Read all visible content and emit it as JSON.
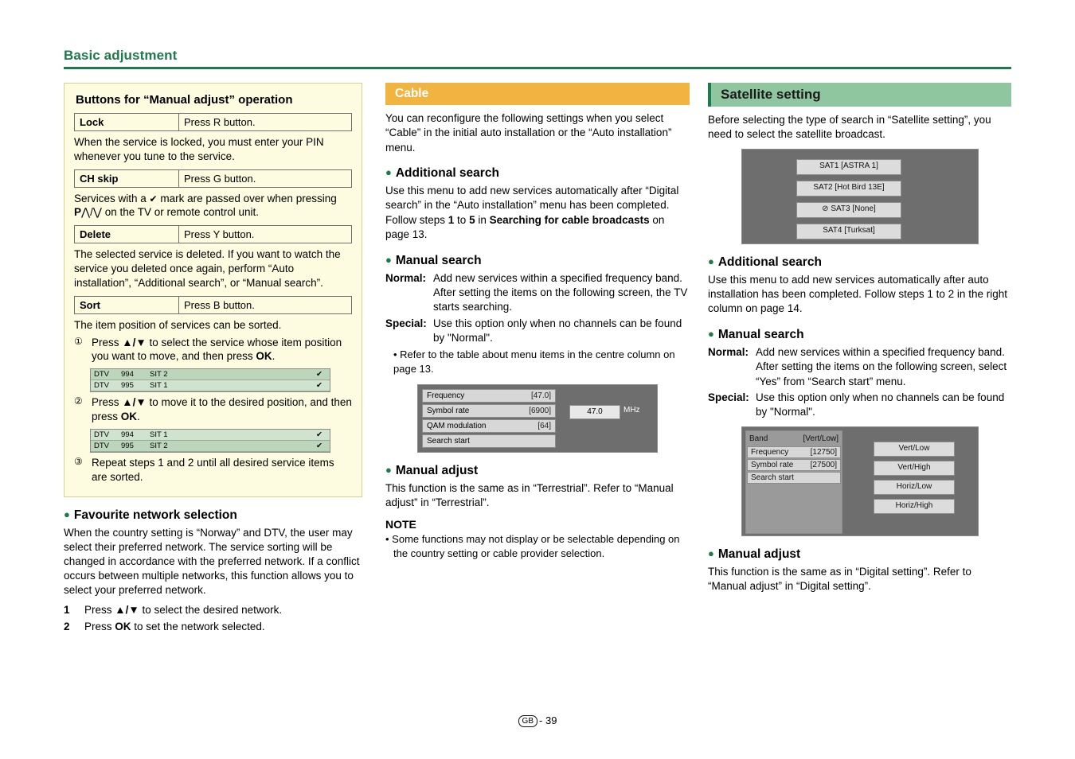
{
  "header": {
    "title": "Basic adjustment"
  },
  "col1": {
    "panel_title": "Buttons for “Manual adjust” operation",
    "rows": [
      {
        "key": "Lock",
        "value": "Press R button."
      },
      {
        "key": "CH skip",
        "value": "Press G button."
      },
      {
        "key": "Delete",
        "value": "Press Y button."
      },
      {
        "key": "Sort",
        "value": "Press B button."
      }
    ],
    "lock_text": "When the service is locked, you must enter your PIN whenever you tune to the service.",
    "chskip_text_1": "Services with a ",
    "chskip_check": "✔",
    "chskip_text_2": " mark are passed over when pressing ",
    "chskip_p": "P",
    "chskip_updown": "/",
    "chskip_text_3": " on the TV or remote control unit.",
    "delete_text": "The selected service is deleted. If you want to watch the service you deleted once again, perform “Auto installation”, “Additional search”, or “Manual search”.",
    "sort_text": "The item position of services can be sorted.",
    "steps": [
      {
        "num": "①",
        "text_a": "Press ",
        "key_a": "▲/▼",
        "text_b": " to select the service whose item position you want to move, and then press ",
        "key_b": "OK",
        "text_c": "."
      },
      {
        "num": "②",
        "text_a": "Press ",
        "key_a": "▲/▼",
        "text_b": " to move it to the desired position, and then press ",
        "key_b": "OK",
        "text_c": "."
      },
      {
        "num": "③",
        "text_a": "Repeat steps 1 and 2 until all desired service items are sorted.",
        "key_a": "",
        "text_b": "",
        "key_b": "",
        "text_c": ""
      }
    ],
    "screen1": [
      {
        "c1": "DTV",
        "c2": "994",
        "c3": "SIT 2",
        "c4": "✔"
      },
      {
        "c1": "DTV",
        "c2": "995",
        "c3": "SIT 1",
        "c4": "✔"
      }
    ],
    "screen2": [
      {
        "c1": "DTV",
        "c2": "994",
        "c3": "SIT 1",
        "c4": "✔"
      },
      {
        "c1": "DTV",
        "c2": "995",
        "c3": "SIT 2",
        "c4": "✔"
      }
    ],
    "fav_heading": "Favourite network selection",
    "fav_text": "When the country setting is “Norway” and DTV, the user may select their preferred network. The service sorting will be changed in accordance with the preferred network. If a conflict occurs between multiple networks, this function allows you to select your preferred network.",
    "numbered": [
      {
        "n": "1",
        "text_a": "Press ",
        "key": "▲/▼",
        "text_b": " to select the desired network."
      },
      {
        "n": "2",
        "text_a": "Press ",
        "key": "OK",
        "text_b": " to set the network selected."
      }
    ]
  },
  "col2": {
    "bar_title": "Cable",
    "intro": "You can reconfigure the following settings when you select “Cable” in the initial auto installation or the “Auto installation” menu.",
    "add_search_heading": "Additional search",
    "add_search_text_a": "Use this menu to add new services automatically after “Digital search” in the “Auto installation” menu has been completed. Follow steps ",
    "add_search_b1": "1",
    "add_search_mid": " to ",
    "add_search_b2": "5",
    "add_search_text_b": " in ",
    "add_search_b3": "Searching for cable broadcasts",
    "add_search_text_c": " on page 13.",
    "manual_search_heading": "Manual search",
    "normal_label": "Normal:",
    "normal_text": "Add new services within a specified frequency band. After setting the items on the following screen, the TV starts searching.",
    "special_label": "Special:",
    "special_text": "Use this option only when no channels can be found by \"Normal\".",
    "special_sub": "• Refer to the table about menu items in the centre column on page 13.",
    "screen_rows": [
      {
        "label": "Frequency",
        "value": "[47.0]"
      },
      {
        "label": "Symbol rate",
        "value": "[6900]"
      },
      {
        "label": "QAM modulation",
        "value": "[64]"
      },
      {
        "label": "Search start",
        "value": ""
      }
    ],
    "screen_field": "47.0",
    "screen_unit": "MHz",
    "manual_adjust_heading": "Manual adjust",
    "manual_adjust_text": "This function is the same as in “Terrestrial”. Refer to “Manual adjust” in “Terrestrial”.",
    "note_heading": "NOTE",
    "note_text": "• Some functions may not display or be selectable depending on the country setting or cable provider selection."
  },
  "col3": {
    "bar_title": "Satellite setting",
    "intro": "Before selecting the type of search in “Satellite setting”, you need to select the satellite broadcast.",
    "sat_buttons": [
      "SAT1 [ASTRA 1]",
      "SAT2 [Hot Bird 13E]",
      "SAT3 [None]",
      "SAT4 [Turksat]"
    ],
    "sat3_icon": "prohibited-icon",
    "add_search_heading": "Additional search",
    "add_search_text": "Use this menu to add new services automatically after auto installation has been completed. Follow steps 1 to 2 in the right column on page 14.",
    "manual_search_heading": "Manual search",
    "normal_label": "Normal:",
    "normal_text": "Add new services within a specified frequency band. After setting the items on the following screen, select “Yes” from “Search start” menu.",
    "special_label": "Special:",
    "special_text": "Use this option only when no channels can be found by \"Normal\".",
    "screen_rows": [
      {
        "label": "Band",
        "value": "[Vert/Low]"
      },
      {
        "label": "Frequency",
        "value": "[12750]"
      },
      {
        "label": "Symbol rate",
        "value": "[27500]"
      },
      {
        "label": "Search start",
        "value": ""
      }
    ],
    "screen_buttons": [
      "Vert/Low",
      "Vert/High",
      "Horiz/Low",
      "Horiz/High"
    ],
    "manual_adjust_heading": "Manual adjust",
    "manual_adjust_text": "This function is the same as in “Digital setting”. Refer to “Manual adjust” in “Digital setting”."
  },
  "footer": {
    "region": "GB",
    "sep": "-",
    "page": "39"
  }
}
